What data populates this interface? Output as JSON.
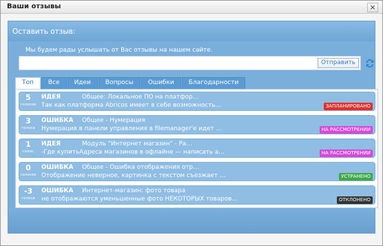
{
  "window": {
    "title": "Ваши отзывы",
    "close_label": "×"
  },
  "panel": {
    "title": "Оставить отзыв:",
    "prompt": "Мы будем рады услышать от Вас отзывы на нашем сайте.",
    "input_value": "",
    "send_label": "Отправить"
  },
  "tabs": [
    "Топ",
    "Все",
    "Идеи",
    "Вопросы",
    "Ошибки",
    "Благодарности"
  ],
  "items": [
    {
      "votes": "5",
      "votes_label": "голосов",
      "type": "ИДЕЯ",
      "topic": "Общее: Локальное ПО на платфор…",
      "desc": "Так как платформа Abricos имеет в себе возможность…",
      "status": "ЗАПЛАНИРОВАНО",
      "status_color": "#e0302c"
    },
    {
      "votes": "3",
      "votes_label": "голоса",
      "type": "ОШИБКА",
      "topic": "Общее - Нумерация",
      "desc": "Нумерация в панели управления в filemanager'е идет …",
      "status": "НА РАССМОТРЕНИИ",
      "status_color": "#d64ad6"
    },
    {
      "votes": "1",
      "votes_label": "голос",
      "type": "ИДЕЯ",
      "topic": "Модуль \"Интернет магазин\" - Ра…",
      "desc": "-Где купитьАдреса магазинов в офлайне — написать а…",
      "status": "НА РАССМОТРЕНИИ",
      "status_color": "#d64ad6"
    },
    {
      "votes": "0",
      "votes_label": "голосов",
      "type": "ОШИБКА",
      "topic": "Общее - Ошибка отображения отр…",
      "desc": "Отображение неверное, картинка с текстом съезжает …",
      "status": "УСТРАНЕНО",
      "status_color": "#3fa84a"
    },
    {
      "votes": "-3",
      "votes_label": "голоса",
      "type": "ОШИБКА",
      "topic": "Интернет-магазин: фото товара",
      "desc": "не отображаются уменьшенные фото НЕКОТОРЫХ товаров…",
      "status": "ОТКЛОНЕНО",
      "status_color": "#333333"
    }
  ],
  "icons": {
    "refresh": "refresh-icon",
    "close": "close-icon"
  }
}
